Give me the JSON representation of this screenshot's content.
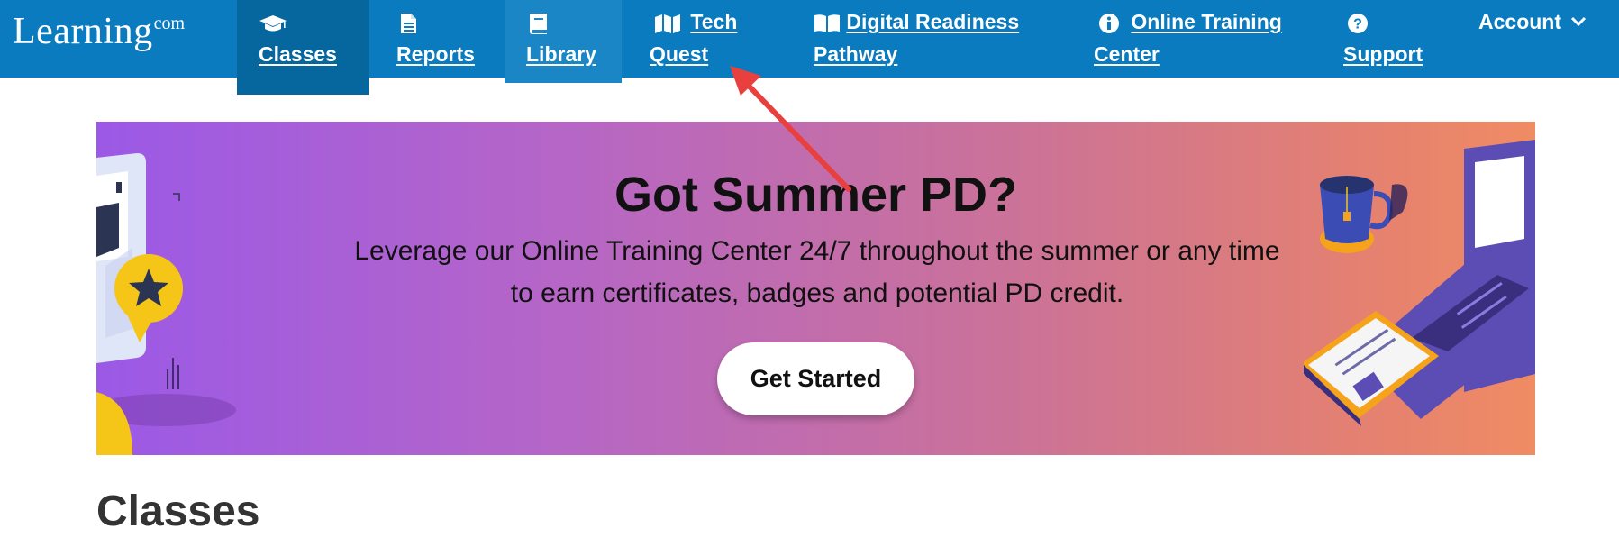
{
  "header": {
    "logo_text": "Learning",
    "logo_suffix": "com",
    "nav": [
      {
        "label": "Classes",
        "icon": "graduation-cap-icon"
      },
      {
        "label": "Reports",
        "icon": "document-icon"
      },
      {
        "label": "Library",
        "icon": "book-icon"
      },
      {
        "label_line1": "Tech",
        "label_line2": "Quest",
        "icon": "map-icon"
      },
      {
        "label_line1": "Digital Readiness",
        "label_line2": "Pathway",
        "icon": "open-book-icon"
      },
      {
        "label_line1": "Online Training",
        "label_line2": "Center",
        "icon": "info-circle-icon"
      },
      {
        "label": "Support",
        "icon": "question-circle-icon"
      }
    ],
    "account_label": "Account",
    "account_icon": "chevron-down-icon"
  },
  "banner": {
    "title": "Got Summer PD?",
    "text": "Leverage our Online Training Center 24/7 throughout the summer or any time to earn certificates, badges and potential PD credit.",
    "button_label": "Get Started"
  },
  "main": {
    "heading": "Classes"
  },
  "colors": {
    "header_bg": "#0a7bbf",
    "active_tab_bg": "#06679f",
    "annotation_arrow": "#e8403f"
  }
}
